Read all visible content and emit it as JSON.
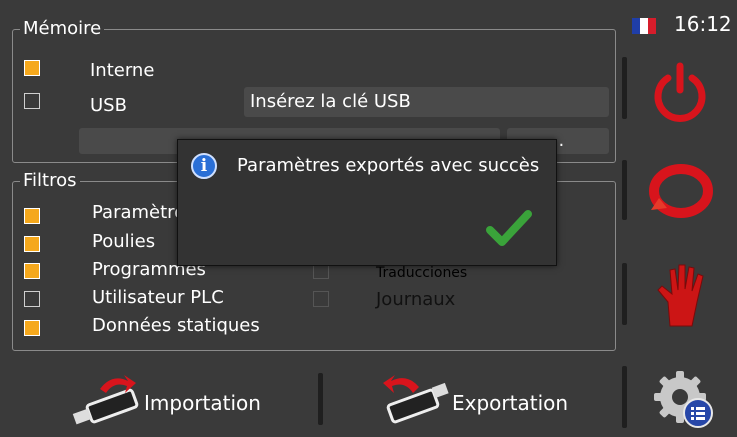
{
  "memory": {
    "title": "Mémoire",
    "internal_label": "Interne",
    "usb_label": "USB",
    "usb_message": "Insérez la clé USB",
    "browse_label": "..."
  },
  "filters": {
    "title": "Filtros",
    "items": [
      {
        "label": "Paramètres",
        "checked": true
      },
      {
        "label": "Poulies",
        "checked": true
      },
      {
        "label": "Programmes",
        "checked": true
      },
      {
        "label": "Utilisateur PLC",
        "checked": false
      },
      {
        "label": "Données statiques",
        "checked": true
      }
    ],
    "right_items": [
      {
        "label": "Traducciones",
        "checked": false
      },
      {
        "label": "Journaux",
        "checked": false
      }
    ]
  },
  "dialog": {
    "message": "Paramètres exportés avec succès",
    "info_icon": "info-icon",
    "ok_icon": "checkmark-icon"
  },
  "status": {
    "time": "16:12",
    "language_flag": "france-flag-icon"
  },
  "side_buttons": [
    {
      "icon": "power-icon"
    },
    {
      "icon": "refresh-icon"
    },
    {
      "icon": "stop-hand-icon"
    }
  ],
  "bottom": {
    "import_label": "Importation",
    "export_label": "Exportation",
    "settings_icon": "settings-gear-icon"
  },
  "colors": {
    "checkbox_on": "#f5a81c",
    "accent_red": "#d8141c",
    "check_green": "#3aa33a",
    "info_blue": "#2a6fd6"
  }
}
